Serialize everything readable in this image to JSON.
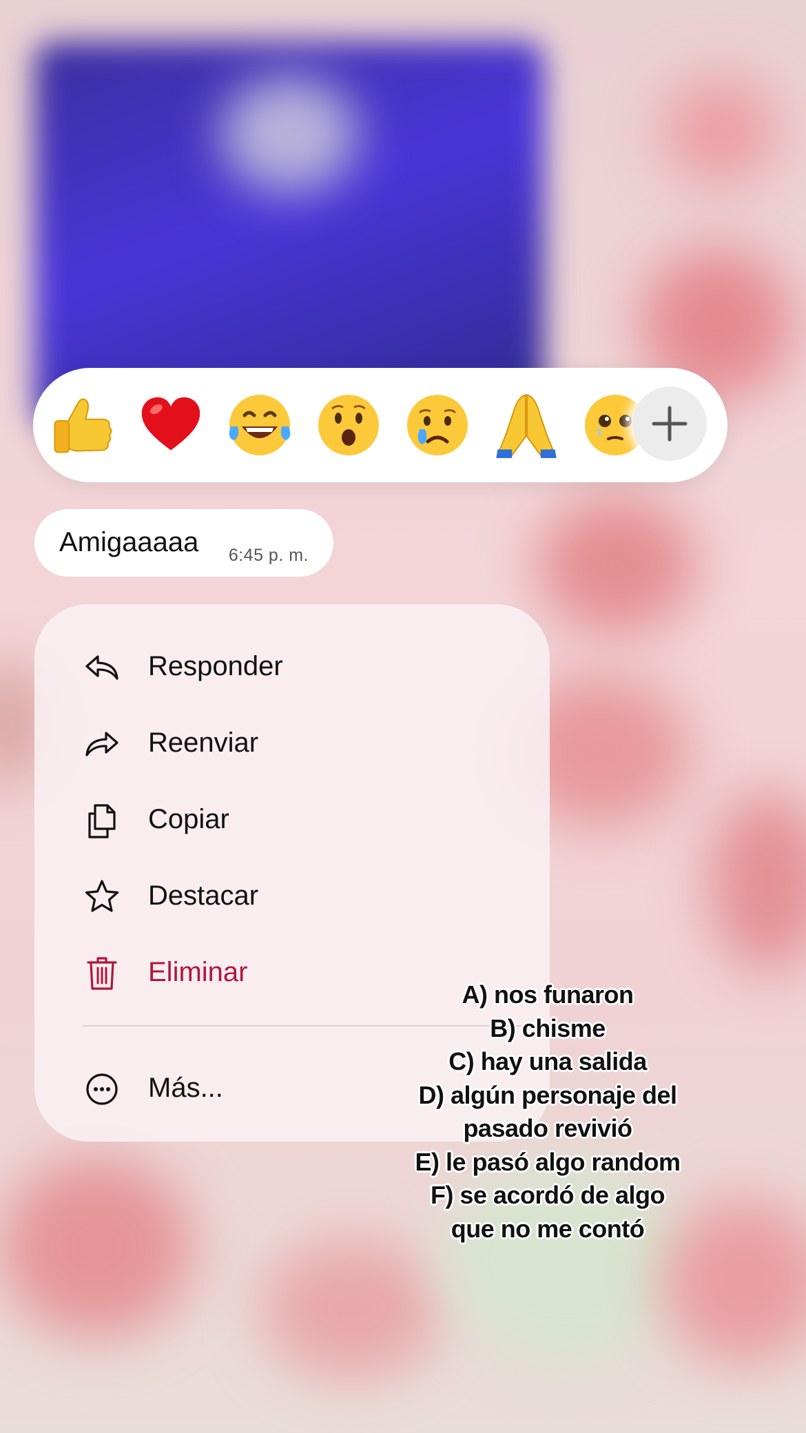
{
  "reaction_bar": {
    "emojis": [
      {
        "name": "thumbs-up",
        "glyph": "👍"
      },
      {
        "name": "red-heart",
        "glyph": "❤️"
      },
      {
        "name": "tears-of-joy",
        "glyph": "😂"
      },
      {
        "name": "surprised-face",
        "glyph": "😮"
      },
      {
        "name": "crying-face",
        "glyph": "😢"
      },
      {
        "name": "folded-hands",
        "glyph": "🙏"
      },
      {
        "name": "holding-back-tears",
        "glyph": "🥹"
      }
    ],
    "more_reactions_icon": "plus-icon"
  },
  "message": {
    "text": "Amigaaaaa",
    "time": "6:45 p. m."
  },
  "menu": {
    "reply": "Responder",
    "forward": "Reenviar",
    "copy": "Copiar",
    "star": "Destacar",
    "delete": "Eliminar",
    "more": "Más..."
  },
  "overlay": {
    "lines": [
      "A) nos funaron",
      "B) chisme",
      "C) hay una salida",
      "D) algún personaje del",
      "pasado revivió",
      "E) le pasó algo random",
      "F) se acordó de algo",
      "que no me contó"
    ]
  },
  "colors": {
    "danger": "#b0163e",
    "menu_bg": "#f9f0f2",
    "bubble_bg": "#ffffff"
  }
}
